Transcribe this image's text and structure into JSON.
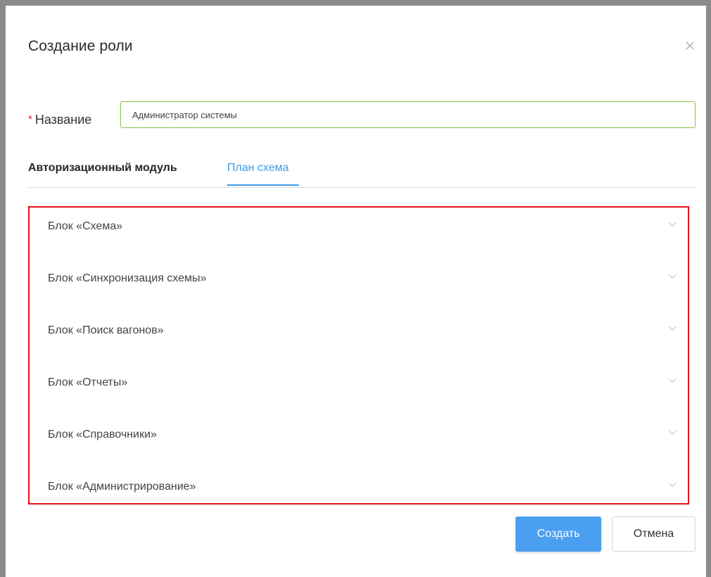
{
  "modal": {
    "title": "Создание роли",
    "close_icon": "close-icon"
  },
  "form": {
    "name_label": "Название",
    "required_mark": "*",
    "name_value": "Администратор системы"
  },
  "tabs": [
    {
      "label": "Авторизационный модуль",
      "active": false
    },
    {
      "label": "План схема",
      "active": true
    }
  ],
  "blocks": [
    {
      "label": "Блок «Схема»",
      "icon": "chevron-down-icon"
    },
    {
      "label": "Блок «Синхронизация схемы»",
      "icon": "chevron-down-icon"
    },
    {
      "label": "Блок «Поиск вагонов»",
      "icon": "chevron-down-icon"
    },
    {
      "label": "Блок «Отчеты»",
      "icon": "chevron-down-icon"
    },
    {
      "label": "Блок «Справочники»",
      "icon": "chevron-down-icon"
    },
    {
      "label": "Блок «Администрирование»",
      "icon": "chevron-down-icon"
    }
  ],
  "footer": {
    "create_label": "Создать",
    "cancel_label": "Отмена"
  },
  "colors": {
    "accent": "#4a9ff0",
    "active_tab": "#3b9ae8",
    "input_border": "#8bc34a",
    "highlight_border": "#e4101a",
    "required": "#f5222d"
  }
}
